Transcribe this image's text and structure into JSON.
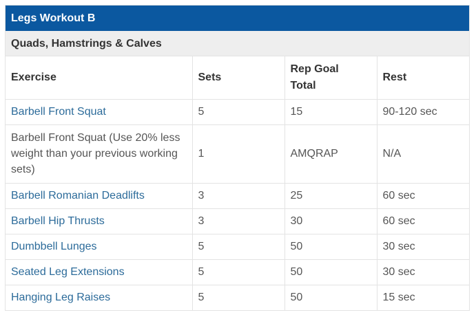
{
  "title": "Legs Workout B",
  "subtitle": "Quads, Hamstrings & Calves",
  "headers": [
    "Exercise",
    "Sets",
    "Rep Goal Total",
    "Rest"
  ],
  "header_rep_line1": "Rep Goal",
  "header_rep_line2": "Total",
  "rows": [
    {
      "exercise": "Barbell Front Squat",
      "link": true,
      "sets": "5",
      "rep": "15",
      "rest": "90-120 sec"
    },
    {
      "exercise": "Barbell Front Squat (Use 20% less weight than your previous working sets)",
      "link": false,
      "sets": "1",
      "rep": "AMQRAP",
      "rest": "N/A"
    },
    {
      "exercise": "Barbell Romanian Deadlifts",
      "link": true,
      "sets": "3",
      "rep": "25",
      "rest": "60 sec"
    },
    {
      "exercise": "Barbell Hip Thrusts",
      "link": true,
      "sets": "3",
      "rep": "30",
      "rest": "60 sec"
    },
    {
      "exercise": "Dumbbell Lunges",
      "link": true,
      "sets": "5",
      "rep": "50",
      "rest": "30 sec"
    },
    {
      "exercise": "Seated Leg Extensions",
      "link": true,
      "sets": "5",
      "rep": "50",
      "rest": "30 sec"
    },
    {
      "exercise": "Hanging Leg Raises",
      "link": true,
      "sets": "5",
      "rep": "50",
      "rest": "15 sec"
    }
  ],
  "colors": {
    "title_bg": "#0b58a0",
    "subtitle_bg": "#eeeeee",
    "link": "#2c6b9a"
  }
}
